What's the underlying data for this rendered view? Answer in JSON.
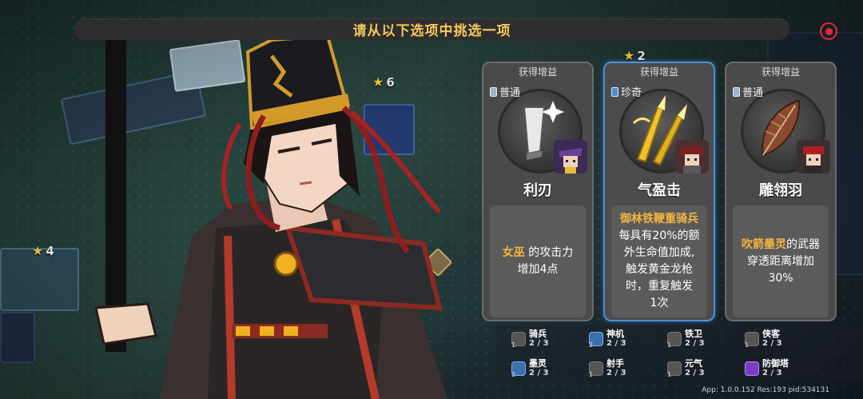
{
  "banner": {
    "title": "请从以下选项中挑选一项"
  },
  "map_badges": [
    {
      "stars": "6"
    },
    {
      "stars": "2"
    },
    {
      "stars": "4"
    }
  ],
  "cards": [
    {
      "header": "获得增益",
      "rarity": "普通",
      "name": "利刃",
      "desc_highlight": "女巫",
      "desc_lines": [
        "的攻击力",
        "增加4点"
      ],
      "icon": "blade-icon"
    },
    {
      "header": "获得增益",
      "rarity": "珍奇",
      "name": "气盈击",
      "desc_highlight": "御林铁鞭重骑兵",
      "desc_lines": [
        "每具有20%的额",
        "外生命值加成,",
        "触发黄金龙枪",
        "时，重复触发",
        "1次"
      ],
      "icon": "golden-spear-icon"
    },
    {
      "header": "获得增益",
      "rarity": "普通",
      "name": "雕翎羽",
      "desc_highlight": "吹箭墨灵",
      "desc_lines": [
        "的武器",
        "穿透距离增加",
        "30%"
      ],
      "icon": "feather-icon"
    }
  ],
  "traits": [
    {
      "name": "骑兵",
      "count": "2 / 3",
      "level": "1"
    },
    {
      "name": "神机",
      "count": "2 / 3",
      "level": "2"
    },
    {
      "name": "铁卫",
      "count": "2 / 3",
      "level": "1"
    },
    {
      "name": "侠客",
      "count": "2 / 3",
      "level": "1"
    },
    {
      "name": "墨灵",
      "count": "2 / 3",
      "level": "2"
    },
    {
      "name": "射手",
      "count": "2 / 3",
      "level": "1"
    },
    {
      "name": "元气",
      "count": "2 / 3",
      "level": "1"
    },
    {
      "name": "防御塔",
      "count": "2 / 3",
      "level": ""
    }
  ],
  "footer": {
    "version": "App: 1.0.0.152 Res:193 pid:534131"
  },
  "colors": {
    "highlight": "#f4b53f",
    "banner_text": "#f4c95d",
    "rare_border": "#4a8fd6"
  }
}
